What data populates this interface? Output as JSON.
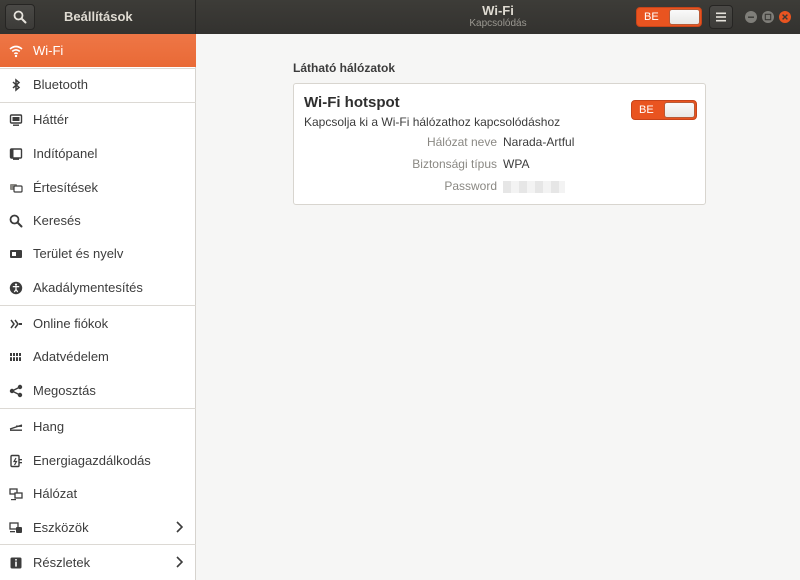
{
  "header": {
    "app_title": "Beállítások",
    "panel_title": "Wi-Fi",
    "panel_subtitle": "Kapcsolódás",
    "wifi_switch_label": "BE",
    "wifi_switch_on": true
  },
  "sidebar": {
    "items": [
      {
        "label": "Wi-Fi",
        "icon": "wifi-icon",
        "active": true
      },
      {
        "label": "Bluetooth",
        "icon": "bluetooth-icon"
      },
      {
        "label": "Háttér",
        "icon": "background-icon"
      },
      {
        "label": "Indítópanel",
        "icon": "dock-icon"
      },
      {
        "label": "Értesítések",
        "icon": "notifications-icon"
      },
      {
        "label": "Keresés",
        "icon": "search-icon"
      },
      {
        "label": "Terület és nyelv",
        "icon": "region-icon"
      },
      {
        "label": "Akadálymentesítés",
        "icon": "accessibility-icon"
      },
      {
        "label": "Online fiókok",
        "icon": "online-accounts-icon"
      },
      {
        "label": "Adatvédelem",
        "icon": "privacy-icon"
      },
      {
        "label": "Megosztás",
        "icon": "share-icon"
      },
      {
        "label": "Hang",
        "icon": "sound-icon"
      },
      {
        "label": "Energiagazdálkodás",
        "icon": "power-icon"
      },
      {
        "label": "Hálózat",
        "icon": "network-icon"
      },
      {
        "label": "Eszközök",
        "icon": "devices-icon",
        "has_submenu": true
      },
      {
        "label": "Részletek",
        "icon": "details-icon",
        "has_submenu": true
      }
    ]
  },
  "main": {
    "section_title": "Látható hálózatok",
    "hotspot": {
      "title": "Wi-Fi hotspot",
      "subtitle": "Kapcsolja ki a Wi-Fi hálózathoz kapcsolódáshoz",
      "switch_label": "BE",
      "switch_on": true,
      "network_name_label": "Hálózat neve",
      "network_name_value": "Narada-Artful",
      "security_label": "Biztonsági típus",
      "security_value": "WPA",
      "password_label": "Password"
    }
  },
  "colors": {
    "accent": "#e95420",
    "headerbar": "#3a3935",
    "sidebar_active": "#ec6f3e"
  }
}
